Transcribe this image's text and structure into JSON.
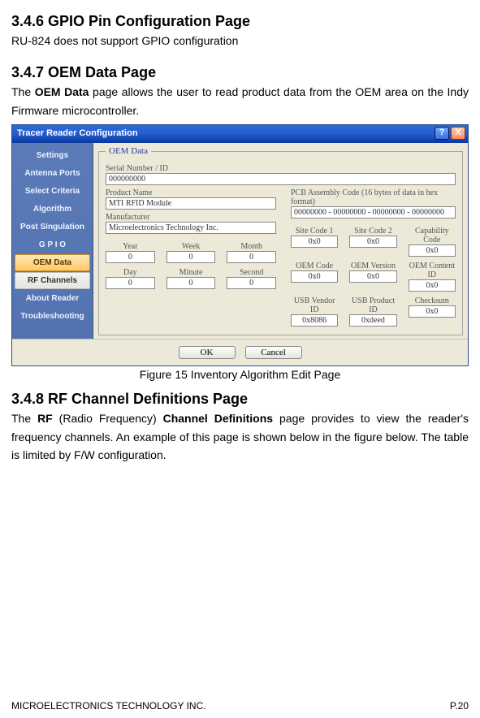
{
  "sections": {
    "s346": {
      "heading": "3.4.6   GPIO Pin Configuration Page",
      "text": "RU-824 does not support GPIO configuration"
    },
    "s347": {
      "heading": "3.4.7   OEM Data Page",
      "text_pre": "The ",
      "text_bold": "OEM Data",
      "text_post": " page allows the user to read product data from the OEM area on the Indy Firmware microcontroller."
    },
    "s348": {
      "heading": "3.4.8   RF Channel Definitions Page",
      "text_1": "The ",
      "text_bold1": "RF",
      "text_2": " (Radio Frequency) ",
      "text_bold2": "Channel Definitions",
      "text_3": " page provides to view the reader's frequency channels. An example of this page is shown below in the figure below. The table is limited by F/W configuration."
    }
  },
  "figure_caption": "Figure 15 Inventory Algorithm Edit Page",
  "window": {
    "title": "Tracer Reader Configuration",
    "help": "?",
    "close": "X",
    "sidebar": [
      "Settings",
      "Antenna Ports",
      "Select Criteria",
      "Algorithm",
      "Post Singulation",
      "G P I O",
      "OEM Data",
      "RF Channels",
      "About Reader",
      "Troubleshooting"
    ],
    "fieldset_legend": "OEM Data",
    "left": {
      "serial_label": "Serial Number / ID",
      "serial_value": "000000000",
      "product_label": "Product Name",
      "product_value": "MTI RFID Module",
      "manufacturer_label": "Manufacturer",
      "manufacturer_value": "Microelectronics Technology Inc.",
      "date_row1": {
        "year_l": "Year",
        "year_v": "0",
        "week_l": "Week",
        "week_v": "0",
        "month_l": "Month",
        "month_v": "0"
      },
      "date_row2": {
        "day_l": "Day",
        "day_v": "0",
        "minute_l": "Minute",
        "minute_v": "0",
        "second_l": "Second",
        "second_v": "0"
      }
    },
    "right": {
      "pcb_label": "PCB Assembly Code (16 bytes of data in hex format)",
      "pcb_value": "00000000 - 00000000 - 00000000 - 00000000",
      "grid1": {
        "site1_l": "Site Code 1",
        "site1_v": "0x0",
        "site2_l": "Site Code 2",
        "site2_v": "0x0",
        "cap_l": "Capability Code",
        "cap_v": "0x0"
      },
      "grid2": {
        "oemc_l": "OEM Code",
        "oemc_v": "0x0",
        "oemv_l": "OEM Version",
        "oemv_v": "0x0",
        "oemid_l": "OEM Content ID",
        "oemid_v": "0x0"
      },
      "grid3": {
        "vend_l": "USB Vendor ID",
        "vend_v": "0x8086",
        "prod_l": "USB Product ID",
        "prod_v": "0xdeed",
        "chk_l": "Checksum",
        "chk_v": "0x0"
      }
    },
    "buttons": {
      "ok": "OK",
      "cancel": "Cancel"
    }
  },
  "footer": {
    "left": "MICROELECTRONICS TECHNOLOGY INC.",
    "right": "P.20"
  }
}
